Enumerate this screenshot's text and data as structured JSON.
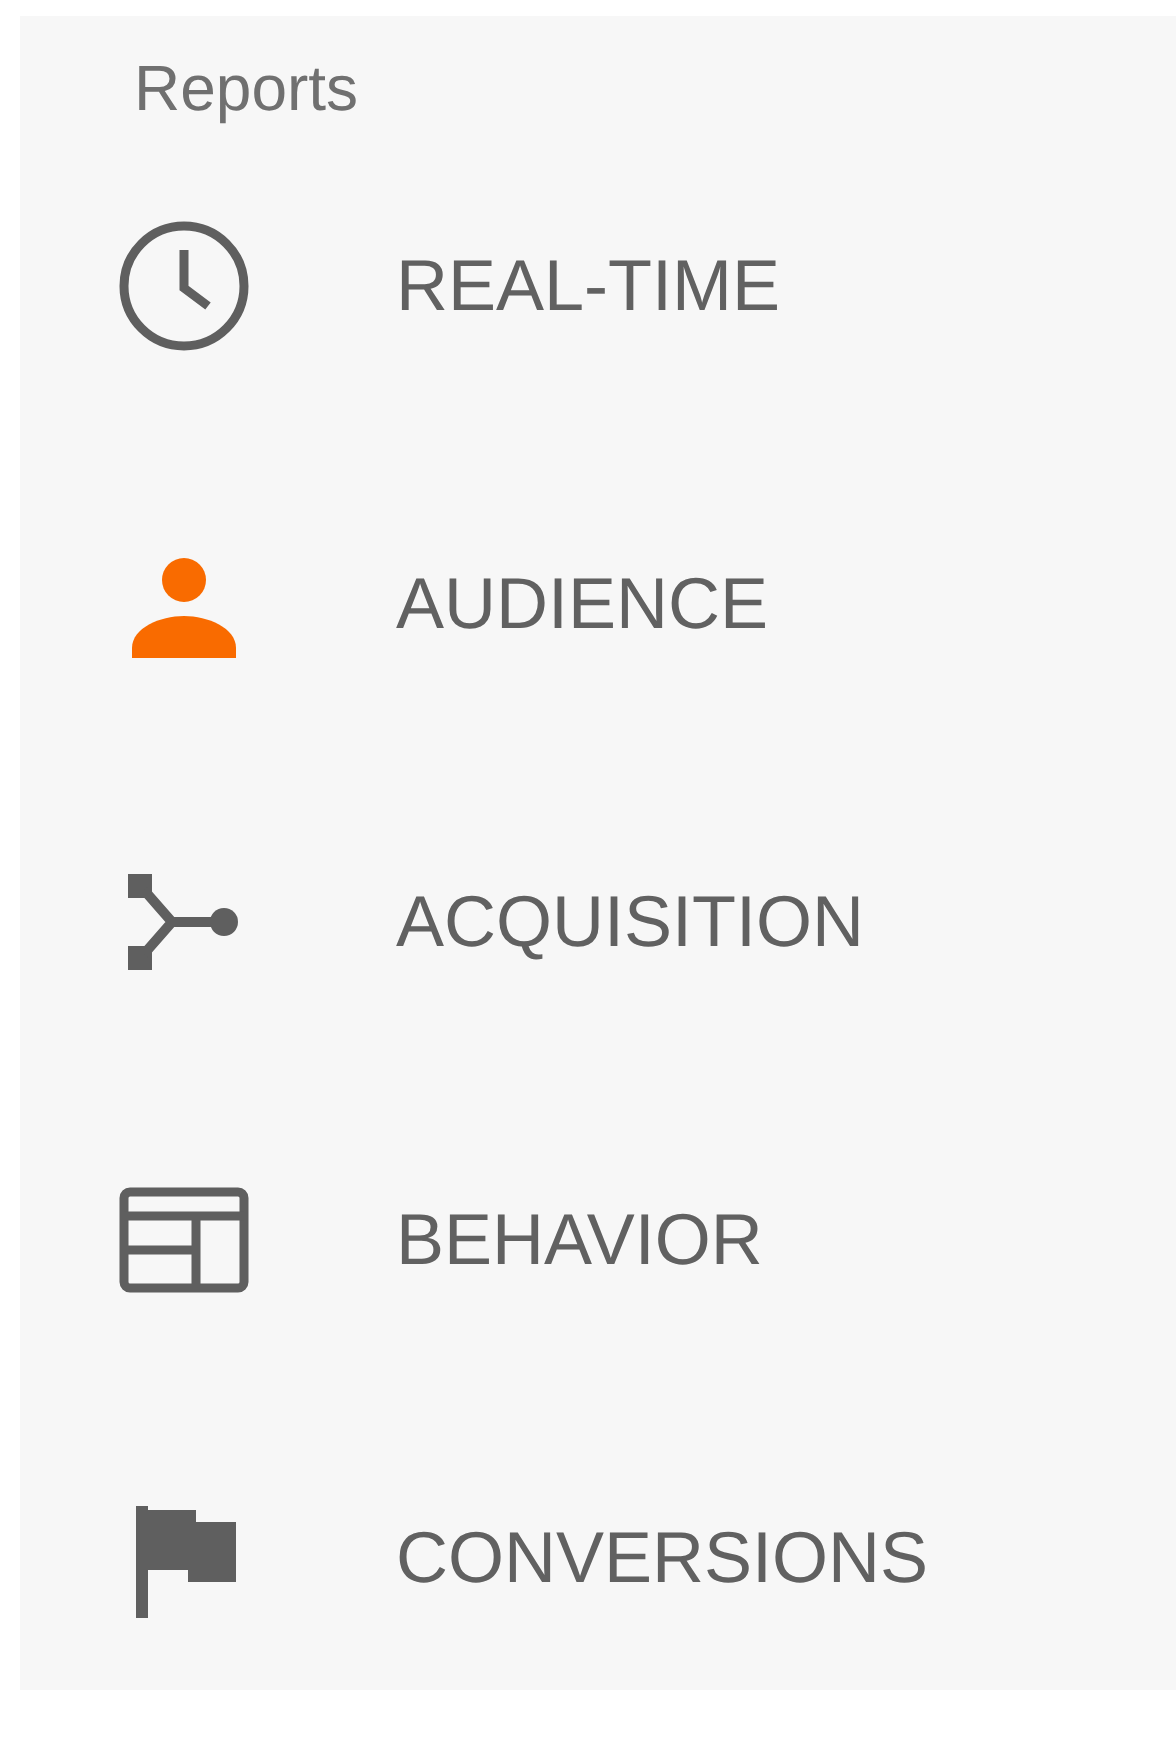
{
  "sidebar": {
    "heading": "Reports",
    "items": [
      {
        "kind": "clock",
        "label": "REAL-TIME",
        "selected": false
      },
      {
        "kind": "person",
        "label": "AUDIENCE",
        "selected": true
      },
      {
        "kind": "fork",
        "label": "ACQUISITION",
        "selected": false
      },
      {
        "kind": "layout",
        "label": "BEHAVIOR",
        "selected": false
      },
      {
        "kind": "flag",
        "label": "CONVERSIONS",
        "selected": false
      }
    ]
  }
}
